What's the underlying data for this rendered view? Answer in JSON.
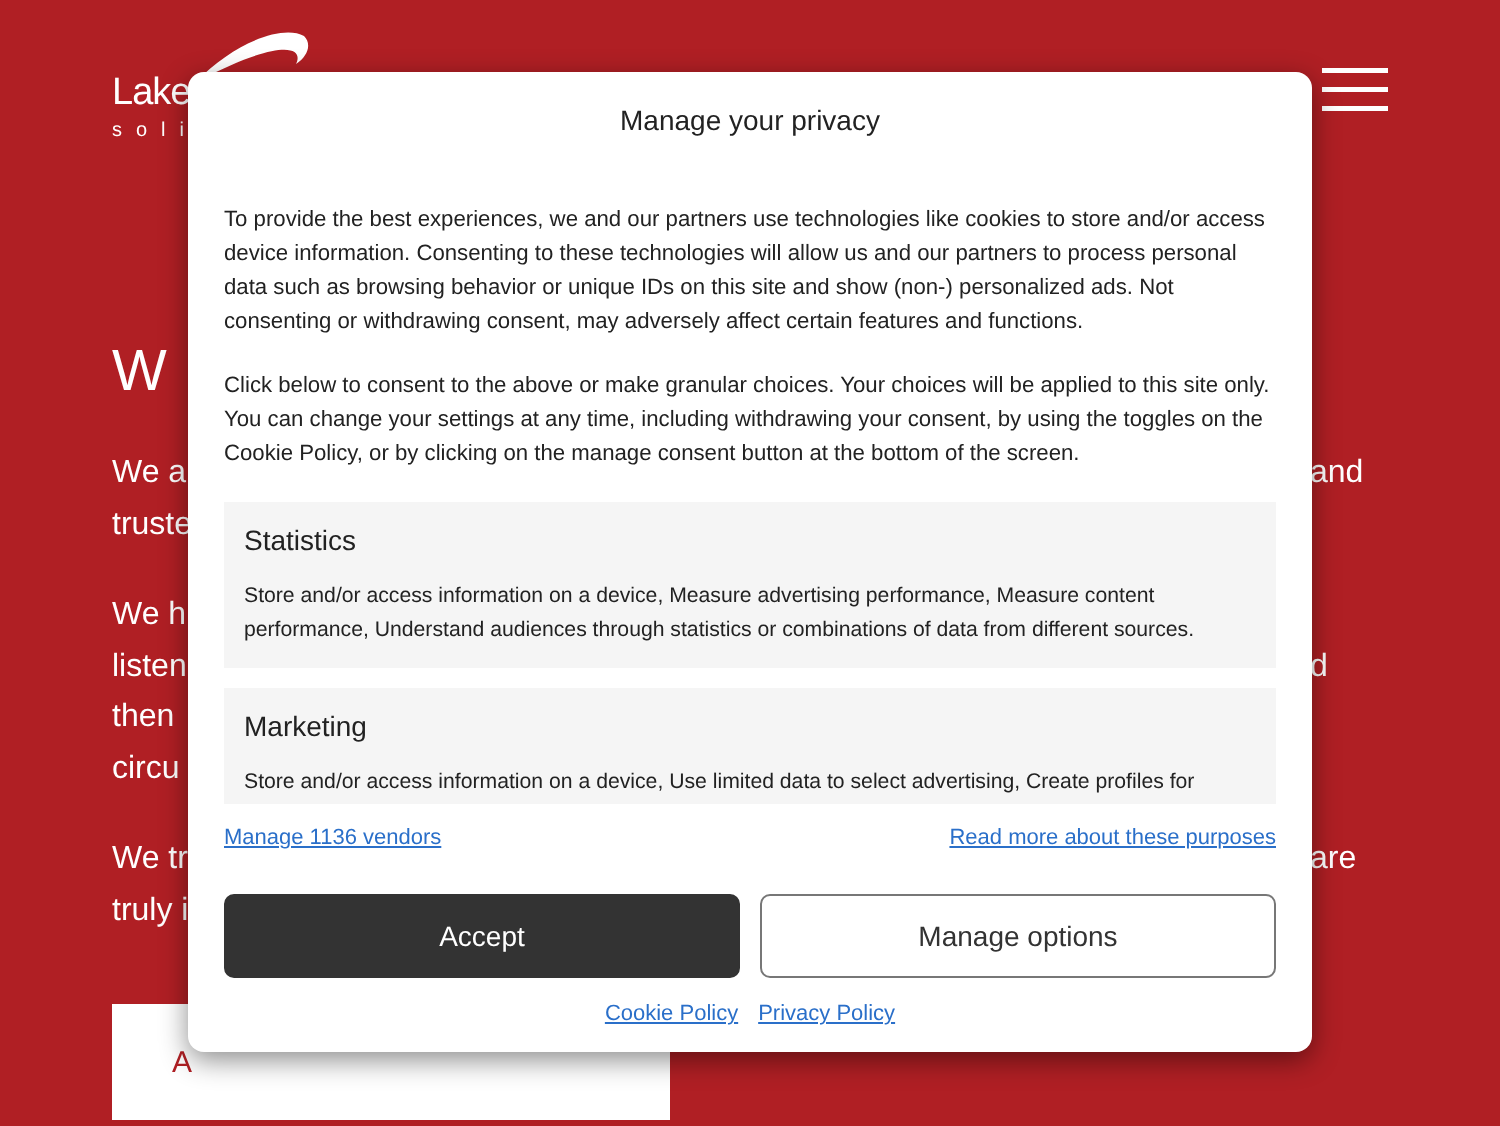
{
  "header": {
    "logo": {
      "name": "Lake",
      "tagline": "soli"
    }
  },
  "hero": {
    "heading": "W",
    "paragraphs": [
      {
        "lines": [
          {
            "left": "We a",
            "right": "and"
          },
          {
            "left": "truste"
          }
        ]
      },
      {
        "lines": [
          {
            "left": "We h"
          },
          {
            "left": "listen",
            "right": "d"
          },
          {
            "left": "then"
          },
          {
            "left": "circu"
          }
        ]
      },
      {
        "lines": [
          {
            "left": "We tr",
            "right": "are"
          },
          {
            "left": "truly i"
          }
        ]
      }
    ],
    "button": "A"
  },
  "consent": {
    "title": "Manage your privacy",
    "paragraphs": [
      "To provide the best experiences, we and our partners use technologies like cookies to store and/or access device information. Consenting to these technologies will allow us and our partners to process personal data such as browsing behavior or unique IDs on this site and show (non-) personalized ads. Not consenting or withdrawing consent, may adversely affect certain features and functions.",
      "Click below to consent to the above or make granular choices. Your choices will be applied to this site only. You can change your settings at any time, including withdrawing your consent, by using the toggles on the Cookie Policy, or by clicking on the manage consent button at the bottom of the screen."
    ],
    "purposes": [
      {
        "title": "Statistics",
        "description": "Store and/or access information on a device, Measure advertising performance, Measure content performance, Understand audiences through statistics or combinations of data from different sources."
      },
      {
        "title": "Marketing",
        "description": "Store and/or access information on a device, Use limited data to select advertising, Create profiles for"
      }
    ],
    "links": [
      "Manage 1136 vendors",
      "Read more about these purposes"
    ],
    "buttons": [
      {
        "label": "Accept",
        "kind": "primary"
      },
      {
        "label": "Manage options",
        "kind": "secondary"
      }
    ],
    "footer_links": [
      "Cookie Policy",
      "Privacy Policy"
    ]
  }
}
